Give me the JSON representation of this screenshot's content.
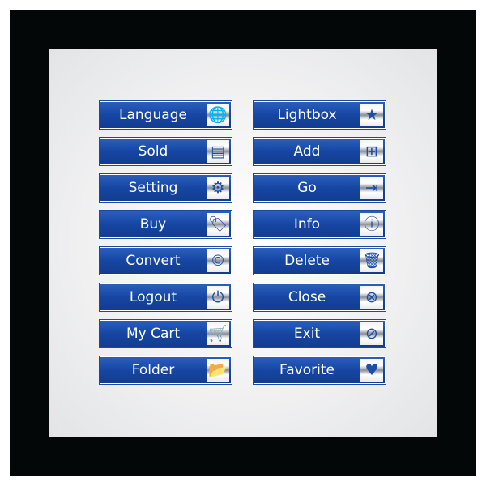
{
  "colors": {
    "button": "#1a4aa8",
    "frame": "#030708",
    "panel": "#f1f1f2",
    "icon": "#1c4ea8"
  },
  "left": [
    {
      "label": "Language",
      "icon": "globe-icon",
      "glyph": "🌐"
    },
    {
      "label": "Sold",
      "icon": "sold-sign-icon",
      "glyph": "▤"
    },
    {
      "label": "Setting",
      "icon": "gear-icon",
      "glyph": "⚙"
    },
    {
      "label": "Buy",
      "icon": "price-tag-icon",
      "glyph": "🏷"
    },
    {
      "label": "Convert",
      "icon": "copyright-icon",
      "glyph": "©"
    },
    {
      "label": "Logout",
      "icon": "power-icon",
      "glyph": "⏻"
    },
    {
      "label": "My Cart",
      "icon": "cart-icon",
      "glyph": "🛒"
    },
    {
      "label": "Folder",
      "icon": "folder-icon",
      "glyph": "📂"
    }
  ],
  "right": [
    {
      "label": "Lightbox",
      "icon": "star-icon",
      "glyph": "★"
    },
    {
      "label": "Add",
      "icon": "add-document-icon",
      "glyph": "⊞"
    },
    {
      "label": "Go",
      "icon": "sign-in-icon",
      "glyph": "⇥"
    },
    {
      "label": "Info",
      "icon": "info-icon",
      "glyph": "ⓘ"
    },
    {
      "label": "Delete",
      "icon": "trash-icon",
      "glyph": "🗑"
    },
    {
      "label": "Close",
      "icon": "close-circle-icon",
      "glyph": "⊗"
    },
    {
      "label": "Exit",
      "icon": "no-entry-icon",
      "glyph": "⊘"
    },
    {
      "label": "Favorite",
      "icon": "heart-icon",
      "glyph": "♥"
    }
  ]
}
